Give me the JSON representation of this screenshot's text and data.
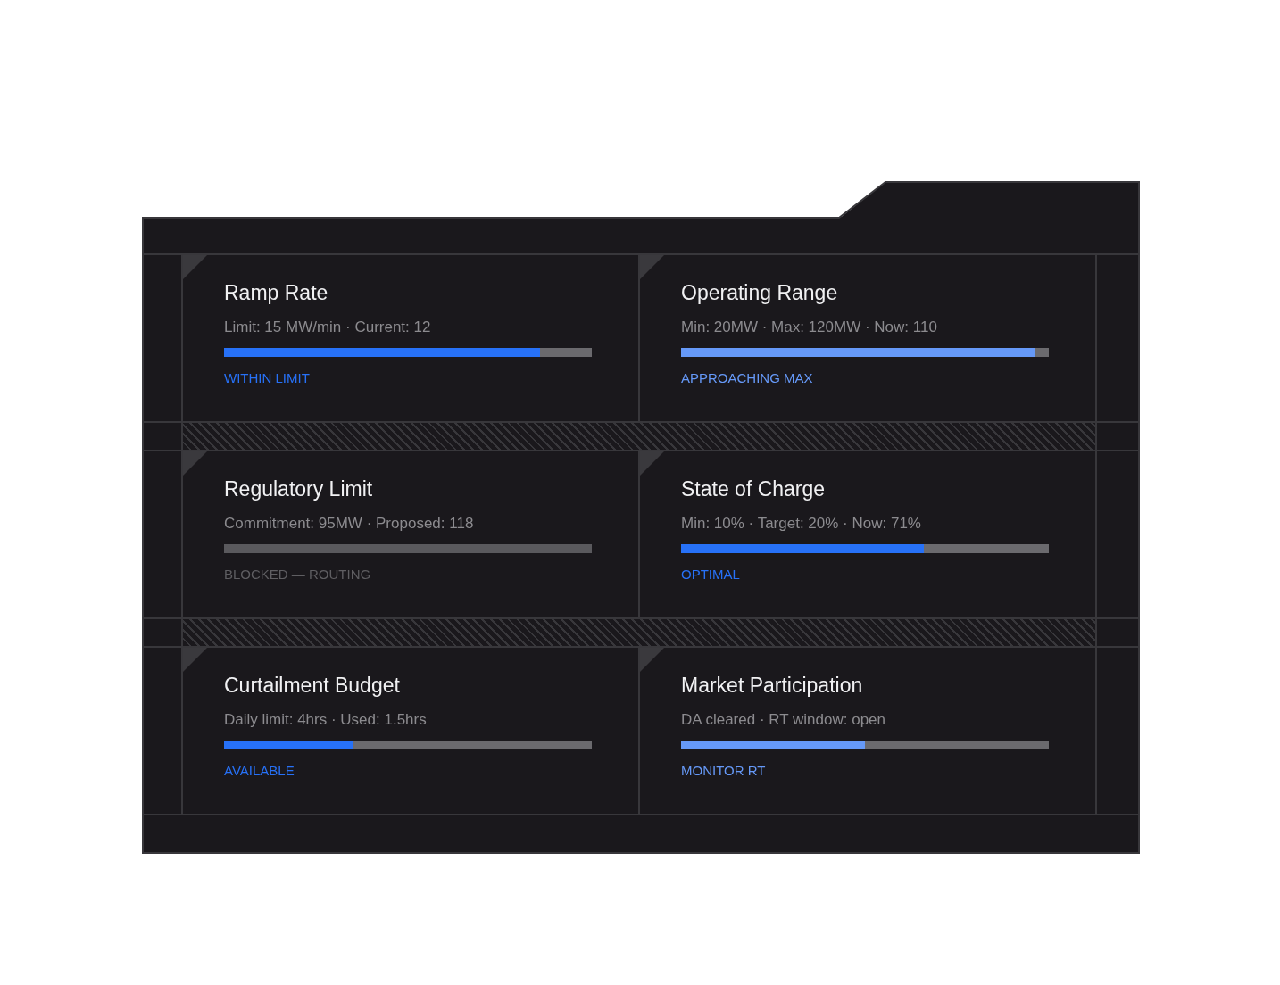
{
  "panel": {
    "metrics": [
      {
        "title": "Ramp Rate",
        "detail": "Limit: 15 MW/min · Current: 12",
        "level": 0.86,
        "disabled": false,
        "status": "WITHIN LIMIT",
        "color": "#2771f7"
      },
      {
        "title": "Operating Range",
        "detail": "Min: 20MW · Max: 120MW · Now: 110",
        "level": 0.96,
        "disabled": false,
        "status": "APPROACHING MAX",
        "color": "#6699f8"
      },
      {
        "title": "Regulatory Limit",
        "detail": "Commitment: 95MW · Proposed: 118",
        "level": 0,
        "disabled": true,
        "status": "BLOCKED — ROUTING",
        "color": "#5f5e62"
      },
      {
        "title": "State of Charge",
        "detail": "Min: 10% · Target: 20% · Now: 71%",
        "level": 0.66,
        "disabled": false,
        "status": "OPTIMAL",
        "color": "#2771f7"
      },
      {
        "title": "Curtailment Budget",
        "detail": "Daily limit: 4hrs · Used: 1.5hrs",
        "level": 0.35,
        "disabled": false,
        "status": "AVAILABLE",
        "color": "#2771f7"
      },
      {
        "title": "Market Participation",
        "detail": "DA cleared · RT window: open",
        "level": 0.5,
        "disabled": false,
        "status": "MONITOR RT",
        "color": "#6699f8"
      }
    ]
  }
}
